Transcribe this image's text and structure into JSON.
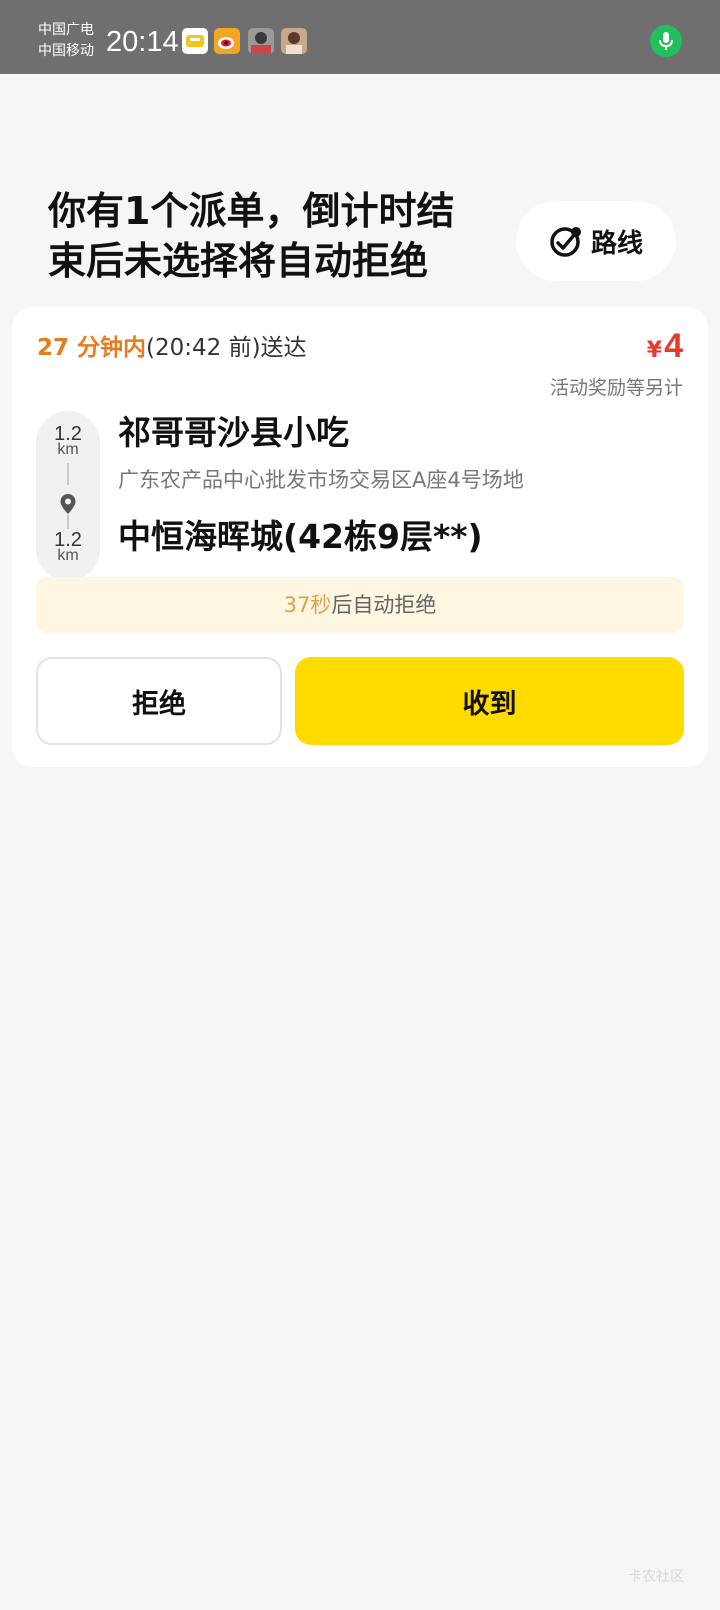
{
  "status_bar": {
    "carrier_1": "中国广电",
    "carrier_2": "中国移动",
    "time": "20:14",
    "notification_icons": [
      "app-icon",
      "weibo-icon",
      "avatar-icon",
      "avatar-icon"
    ],
    "mic_icon": "microphone-icon",
    "mic_color": "#20c05c"
  },
  "header": {
    "message": "你有1个派单，倒计时结束后未选择将自动拒绝",
    "route_button": {
      "label": "路线",
      "icon": "route-icon"
    }
  },
  "order": {
    "eta_highlight": "27 分钟内",
    "eta_detail": "(20:42 前)送达",
    "price_currency": "¥",
    "price_amount": "4",
    "price_note": "活动奖励等另计",
    "pickup_distance": "1.2",
    "pickup_unit": "km",
    "dropoff_distance": "1.2",
    "dropoff_unit": "km",
    "store_name": "祁哥哥沙县小吃",
    "store_address": "广东农产品中心批发市场交易区A座4号场地",
    "destination": "中恒海晖城(42栋9层**)"
  },
  "auto_reject": {
    "seconds": "37秒",
    "text": "后自动拒绝"
  },
  "actions": {
    "reject_label": "拒绝",
    "accept_label": "收到"
  },
  "colors": {
    "accent_orange": "#e87b1e",
    "price_red": "#e43b2d",
    "accept_yellow": "#ffdb00"
  },
  "watermark": "卡农社区"
}
